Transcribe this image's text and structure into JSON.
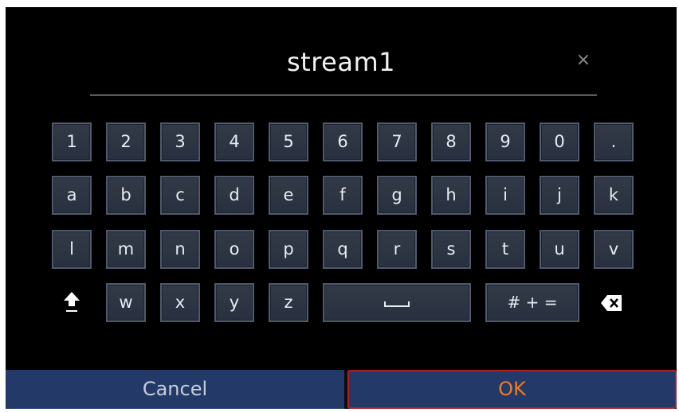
{
  "input": {
    "value": "stream1",
    "clear_glyph": "×"
  },
  "keys": {
    "row1": [
      "1",
      "2",
      "3",
      "4",
      "5",
      "6",
      "7",
      "8",
      "9",
      "0",
      "."
    ],
    "row2": [
      "a",
      "b",
      "c",
      "d",
      "e",
      "f",
      "g",
      "h",
      "i",
      "j",
      "k"
    ],
    "row3": [
      "l",
      "m",
      "n",
      "o",
      "p",
      "q",
      "r",
      "s",
      "t",
      "u",
      "v"
    ],
    "row4": {
      "letters": [
        "w",
        "x",
        "y",
        "z"
      ],
      "symbols_label": "# + ="
    }
  },
  "icons": {
    "shift": "shift-arrow-icon",
    "space": "space-bar-icon",
    "backspace": "backspace-icon"
  },
  "buttons": {
    "cancel": "Cancel",
    "ok": "OK"
  },
  "colors": {
    "ok_text": "#f07a24",
    "ok_border": "#b01f26",
    "bar": "#233a69",
    "key": "#2d3441"
  }
}
